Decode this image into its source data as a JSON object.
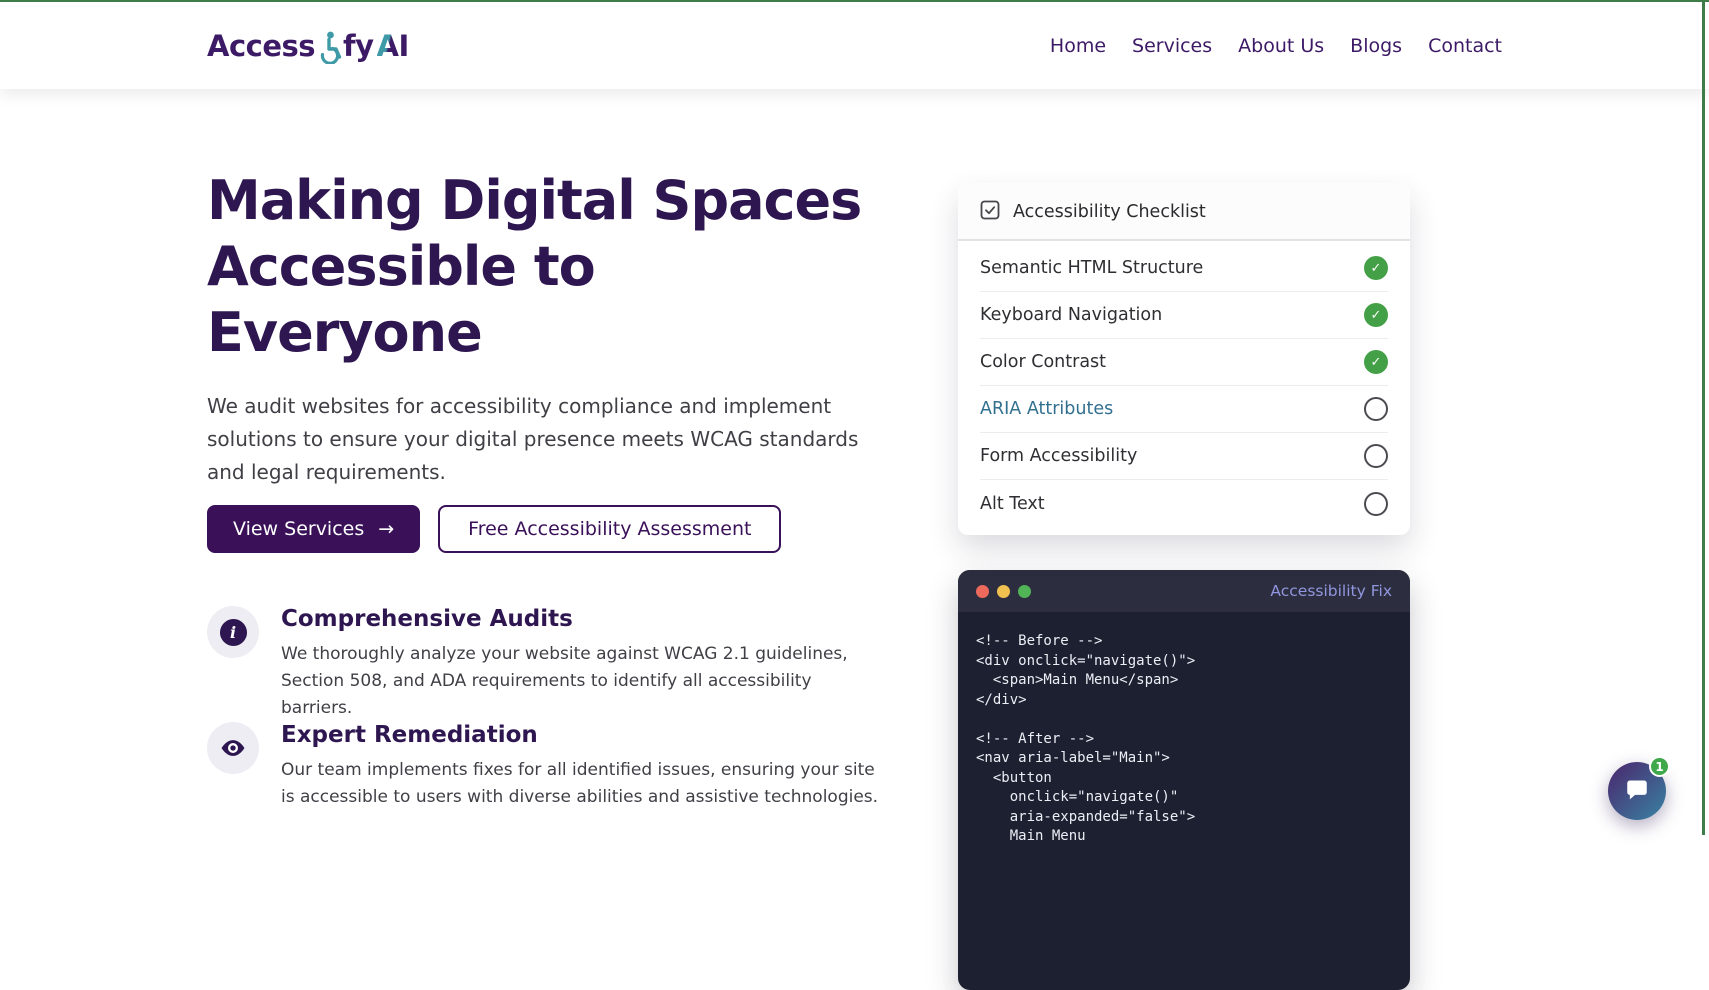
{
  "window": {
    "frame_color": "#3e7d48"
  },
  "header": {
    "logo": {
      "part1": "Access",
      "part2": "fy",
      "part3_a": "A",
      "part3_i": "I"
    },
    "nav": {
      "items": [
        {
          "label": "Home"
        },
        {
          "label": "Services"
        },
        {
          "label": "About Us"
        },
        {
          "label": "Blogs"
        },
        {
          "label": "Contact"
        }
      ]
    }
  },
  "hero": {
    "title": "Making Digital Spaces Accessible to Everyone",
    "title_lines": [
      "Making Digital Spaces",
      "Accessible to",
      "Everyone"
    ],
    "description": "We audit websites for accessibility compliance and implement solutions to ensure your digital presence meets WCAG standards and legal requirements.",
    "primary_button": {
      "label": "View Services",
      "arrow": "→"
    },
    "secondary_button": {
      "label": "Free Accessibility Assessment"
    },
    "features": [
      {
        "icon": "info-icon",
        "title": "Comprehensive Audits",
        "description": "We thoroughly analyze your website against WCAG 2.1 guidelines, Section 508, and ADA requirements to identify all accessibility barriers."
      },
      {
        "icon": "eye-icon",
        "title": "Expert Remediation",
        "description": "Our team implements fixes for all identified issues, ensuring your site is accessible to users with diverse abilities and assistive technologies."
      }
    ]
  },
  "checklist": {
    "title": "Accessibility Checklist",
    "items": [
      {
        "label": "Semantic HTML Structure",
        "status": "checked"
      },
      {
        "label": "Keyboard Navigation",
        "status": "checked"
      },
      {
        "label": "Color Contrast",
        "status": "checked"
      },
      {
        "label": "ARIA Attributes",
        "status": "unchecked",
        "highlighted": true
      },
      {
        "label": "Form Accessibility",
        "status": "unchecked"
      },
      {
        "label": "Alt Text",
        "status": "unchecked"
      }
    ],
    "check_glyph": "✓",
    "checked_color": "#43a047",
    "highlight_color": "#31708f"
  },
  "code_card": {
    "title": "Accessibility Fix",
    "lines": [
      "<!-- Before -->",
      "<div onclick=\"navigate()\">",
      "  <span>Main Menu</span>",
      "</div>",
      "",
      "<!-- After -->",
      "<nav aria-label=\"Main\">",
      "  <button",
      "    onclick=\"navigate()\"",
      "    aria-expanded=\"false\">",
      "    Main Menu"
    ]
  },
  "chat": {
    "badge_count": "1"
  },
  "colors": {
    "brand_purple": "#3d1a66",
    "heading_purple": "#2e1650",
    "button_purple": "#3a1159",
    "accent_teal": "#3e9aa6",
    "code_bg": "#1d2030",
    "code_header_bg": "#2c2e40"
  }
}
